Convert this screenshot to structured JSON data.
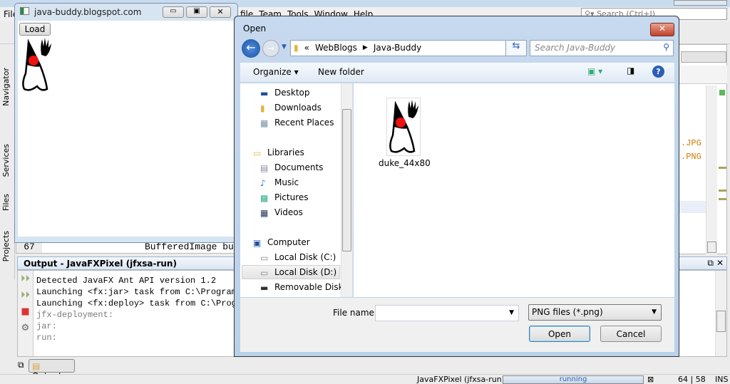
{
  "ide": {
    "menu": [
      "File",
      "file",
      "Team",
      "Tools",
      "Window",
      "Help"
    ],
    "search_placeholder": "Search (Ctrl+I)",
    "side_tabs": [
      "Navigator",
      "Services",
      "Files",
      "Projects"
    ],
    "editor_line_number": "67",
    "editor_line_text": "BufferedImage bu",
    "editor_right_snippets": [
      ".JPG",
      ".PNG"
    ],
    "output_title": "Output - JavaFXPixel (jfxsa-run)",
    "output_lines": [
      {
        "text": "Detected JavaFX Ant API version 1.2",
        "muted": false
      },
      {
        "text": "Launching <fx:jar> task from C:\\Program",
        "muted": false
      },
      {
        "text": "Launching <fx:deploy> task from C:\\Progr",
        "muted": false
      },
      {
        "text": "jfx-deployment:",
        "muted": true
      },
      {
        "text": "jar:",
        "muted": true
      },
      {
        "text": "run:",
        "muted": true
      }
    ],
    "bottom_tab": "Output",
    "status": {
      "project": "JavaFXPixel (jfxsa-run)",
      "progress_text": "running",
      "position": "64 | 58",
      "mode": "INS"
    }
  },
  "app_window": {
    "title": "java-buddy.blogspot.com",
    "load_button": "Load"
  },
  "dialog": {
    "title": "Open",
    "breadcrumb": [
      "«",
      "WebBlogs",
      "Java-Buddy"
    ],
    "search_placeholder": "Search Java-Buddy",
    "organize": "Organize",
    "new_folder": "New folder",
    "nav": [
      {
        "label": "Desktop",
        "icon": "desktop-icon"
      },
      {
        "label": "Downloads",
        "icon": "downloads-icon"
      },
      {
        "label": "Recent Places",
        "icon": "recent-places-icon"
      },
      {
        "label": "Libraries",
        "icon": "libraries-icon",
        "group": true
      },
      {
        "label": "Documents",
        "icon": "documents-icon"
      },
      {
        "label": "Music",
        "icon": "music-icon"
      },
      {
        "label": "Pictures",
        "icon": "pictures-icon"
      },
      {
        "label": "Videos",
        "icon": "videos-icon"
      },
      {
        "label": "Computer",
        "icon": "computer-icon",
        "group": true
      },
      {
        "label": "Local Disk (C:)",
        "icon": "disk-icon"
      },
      {
        "label": "Local Disk (D:)",
        "icon": "disk-icon",
        "selected": true
      },
      {
        "label": "Removable Disk (",
        "icon": "removable-disk-icon"
      }
    ],
    "files": [
      {
        "name": "duke_44x80"
      }
    ],
    "file_name_label": "File name:",
    "file_name_value": "",
    "filter": "PNG files (*.png)",
    "open_button": "Open",
    "cancel_button": "Cancel"
  }
}
